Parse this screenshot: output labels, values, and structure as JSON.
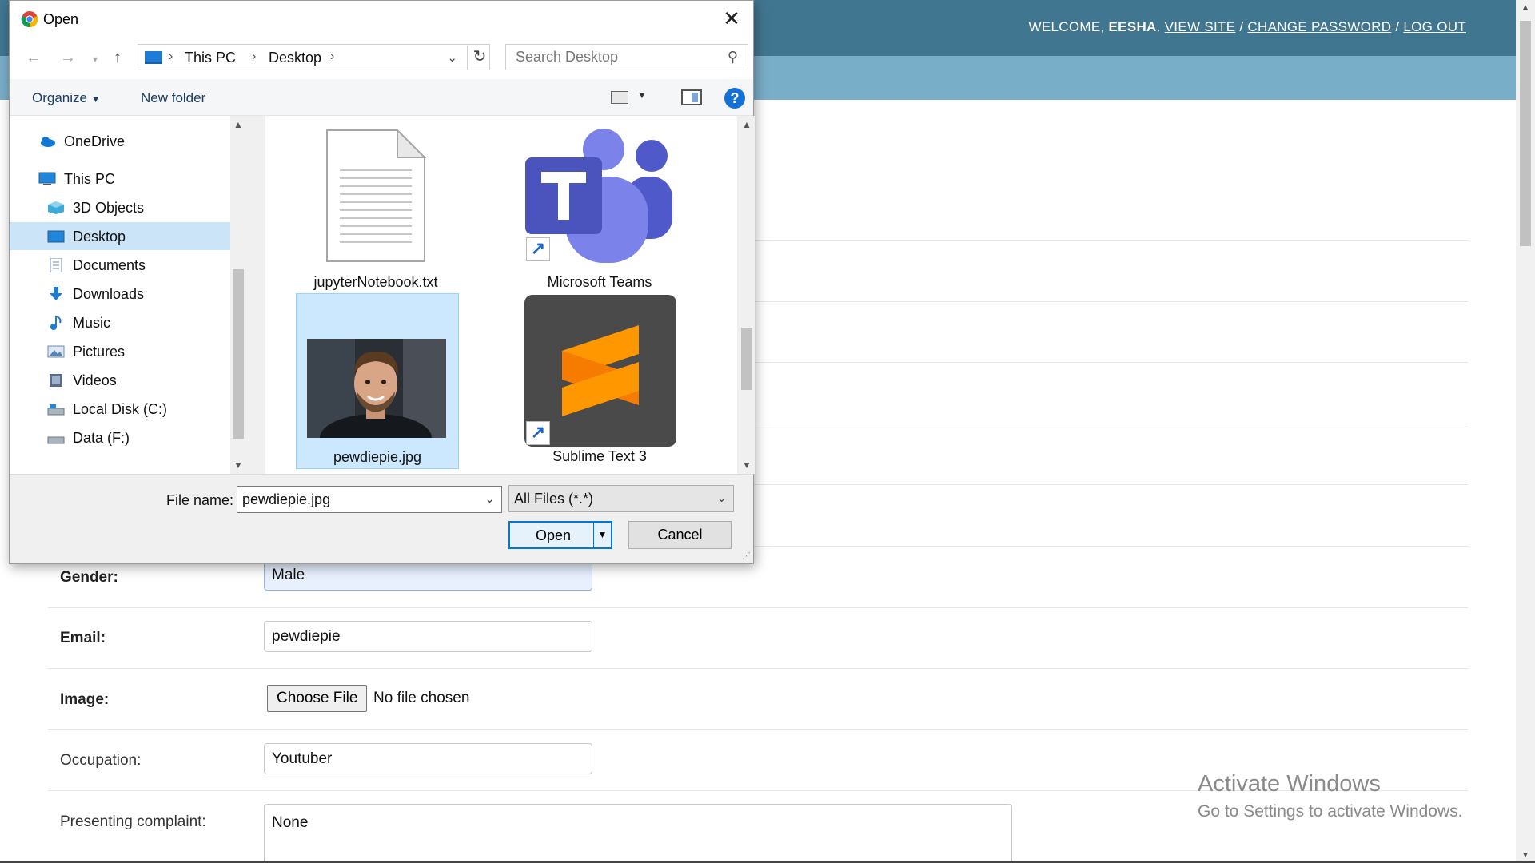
{
  "page": {
    "welcome": "WELCOME,",
    "user": "EESHA",
    "view_site": "VIEW SITE",
    "change_password": "CHANGE PASSWORD",
    "log_out": "LOG OUT",
    "sep": "/",
    "fields": {
      "gender": {
        "label": "Gender:",
        "value": "Male"
      },
      "email": {
        "label": "Email:",
        "value": "pewdiepie"
      },
      "image": {
        "label": "Image:",
        "button": "Choose File",
        "status": "No file chosen"
      },
      "occupation": {
        "label": "Occupation:",
        "value": "Youtuber"
      },
      "complaint": {
        "label": "Presenting complaint:",
        "value": "None"
      }
    }
  },
  "watermark": {
    "line1": "Activate Windows",
    "line2": "Go to Settings to activate Windows."
  },
  "dialog": {
    "title": "Open",
    "breadcrumb": [
      "This PC",
      "Desktop"
    ],
    "search_placeholder": "Search Desktop",
    "organize": "Organize",
    "new_folder": "New folder",
    "nav": [
      {
        "label": "OneDrive",
        "icon": "cloud-icon"
      },
      {
        "label": "This PC",
        "icon": "computer-icon"
      },
      {
        "label": "3D Objects",
        "icon": "cube-icon"
      },
      {
        "label": "Desktop",
        "icon": "desktop-icon",
        "selected": true
      },
      {
        "label": "Documents",
        "icon": "document-icon"
      },
      {
        "label": "Downloads",
        "icon": "download-icon"
      },
      {
        "label": "Music",
        "icon": "music-icon"
      },
      {
        "label": "Pictures",
        "icon": "pictures-icon"
      },
      {
        "label": "Videos",
        "icon": "video-icon"
      },
      {
        "label": "Local Disk (C:)",
        "icon": "drive-icon"
      },
      {
        "label": "Data (F:)",
        "icon": "drive-icon"
      }
    ],
    "files": [
      {
        "name": "jupyterNotebook.txt",
        "icon": "text-file-icon"
      },
      {
        "name": "Microsoft Teams",
        "icon": "teams-icon"
      },
      {
        "name": "pewdiepie.jpg",
        "icon": "photo-thumbnail",
        "selected": true
      },
      {
        "name": "Sublime Text 3",
        "icon": "sublime-icon"
      }
    ],
    "file_name_label": "File name:",
    "file_name_value": "pewdiepie.jpg",
    "filter": "All Files (*.*)",
    "open_button": "Open",
    "cancel_button": "Cancel"
  }
}
